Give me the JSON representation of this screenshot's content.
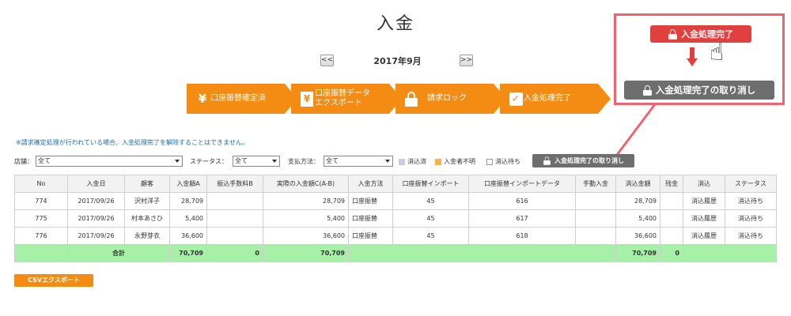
{
  "page": {
    "title": "入金"
  },
  "month_nav": {
    "prev_label": "<<",
    "next_label": ">>",
    "current": "2017年9月"
  },
  "steps": [
    {
      "icon": "yen-icon",
      "glyph": "¥",
      "label": "口座振替確定済"
    },
    {
      "icon": "document-yen-icon",
      "glyph": "¥",
      "label": "口座振替データ エクスポート"
    },
    {
      "icon": "lock-icon",
      "label": "請求ロック"
    },
    {
      "icon": "checkbox-icon",
      "glyph": "✓",
      "label": "入金処理完了"
    }
  ],
  "callout": {
    "complete_button": "入金処理完了",
    "cancel_button": "入金処理完了の取り消し",
    "hand_glyph": "☝"
  },
  "notice": "※請求確定処理が行われている場合、入金処理完了を解除することはできません。",
  "filters": {
    "store_label": "店舗：",
    "store_value": "全て",
    "status_label": "ステータス：",
    "status_value": "全て",
    "payment_label": "支払方法：",
    "payment_value": "全て",
    "legend": [
      {
        "label": "消込済",
        "color": "#c9cbe8"
      },
      {
        "label": "入金者不明",
        "color": "#f7b14d"
      },
      {
        "label": "消込待ち",
        "color": "#ffffff"
      }
    ],
    "unlock_button": "入金処理完了の取り消し"
  },
  "table": {
    "headers": [
      "No",
      "入金日",
      "顧客",
      "入金額A",
      "振込手数料B",
      "実際の入金額C(A-B)",
      "入金方法",
      "口座振替インポート",
      "口座振替インポートデータ",
      "手動入金",
      "消込金額",
      "残金",
      "消込",
      "ステータス"
    ],
    "rows": [
      {
        "no": "774",
        "date": "2017/09/26",
        "customer": "沢村洋子",
        "amount_a": "28,709",
        "fee_b": "",
        "actual_c": "28,709",
        "method": "口座振替",
        "import": "45",
        "import_data": "616",
        "manual": "",
        "cleared": "28,709",
        "balance": "",
        "clear_link": "消込履歴",
        "status": "消込待ち"
      },
      {
        "no": "775",
        "date": "2017/09/26",
        "customer": "村本あさひ",
        "amount_a": "5,400",
        "fee_b": "",
        "actual_c": "5,400",
        "method": "口座振替",
        "import": "45",
        "import_data": "617",
        "manual": "",
        "cleared": "5,400",
        "balance": "",
        "clear_link": "消込履歴",
        "status": "消込待ち"
      },
      {
        "no": "776",
        "date": "2017/09/26",
        "customer": "永野芽衣",
        "amount_a": "36,600",
        "fee_b": "",
        "actual_c": "36,600",
        "method": "口座振替",
        "import": "45",
        "import_data": "618",
        "manual": "",
        "cleared": "36,600",
        "balance": "",
        "clear_link": "消込履歴",
        "status": "消込待ち"
      }
    ],
    "total": {
      "label": "合計",
      "amount_a": "70,709",
      "fee_b": "0",
      "actual_c": "70,709",
      "cleared": "70,709",
      "balance": "0"
    }
  },
  "csv_button": "CSVエクスポート"
}
